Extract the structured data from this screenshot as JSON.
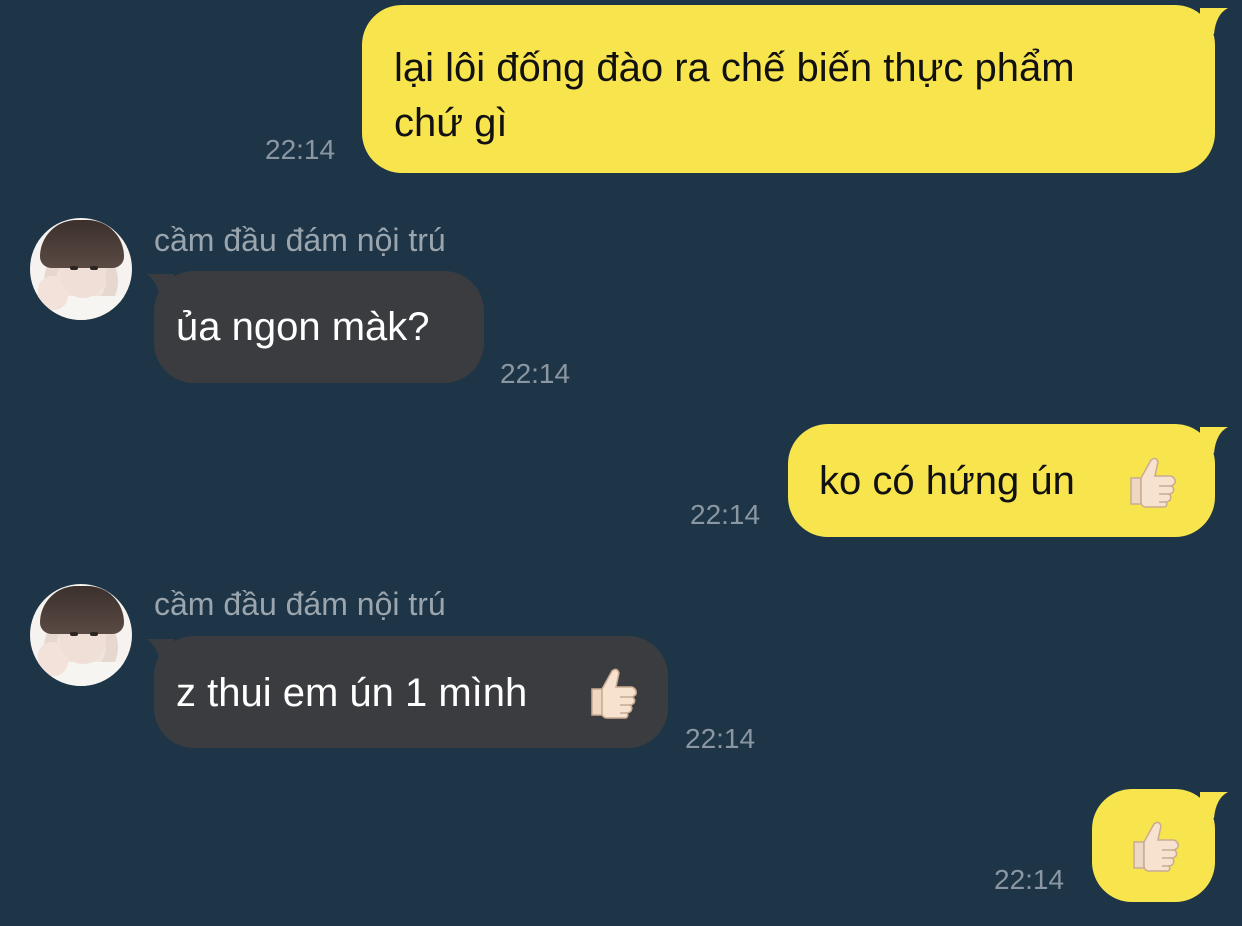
{
  "messages": [
    {
      "direction": "outgoing",
      "line1": "lại lôi đống đào ra chế biến thực phẩm",
      "line2": "chứ gì",
      "time": "22:14"
    },
    {
      "direction": "incoming",
      "sender": "cầm đầu đám nội trú",
      "text": "ủa ngon màk?",
      "time": "22:14"
    },
    {
      "direction": "outgoing",
      "text": "ko có hứng ún",
      "emoji": "thumbs-up",
      "time": "22:14"
    },
    {
      "direction": "incoming",
      "sender": "cầm đầu đám nội trú",
      "text": "z thui em ún 1 mình",
      "emoji": "thumbs-up",
      "time": "22:14"
    },
    {
      "direction": "outgoing",
      "emoji": "thumbs-up",
      "time": "22:14"
    }
  ],
  "colors": {
    "background": "#1e3547",
    "outgoing_bubble": "#f8e54e",
    "incoming_bubble": "#3a3c3f",
    "timestamp": "#8a97a2"
  }
}
